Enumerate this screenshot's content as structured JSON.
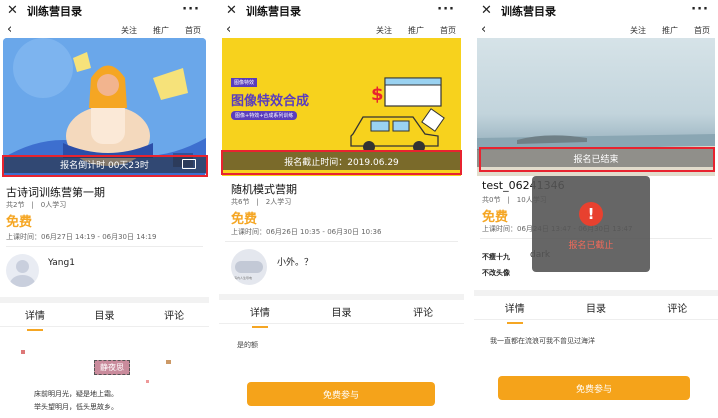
{
  "common": {
    "app_title": "训练营目录",
    "nav_follow": "关注",
    "nav_promote": "推广",
    "nav_home": "首页",
    "tabs": [
      "详情",
      "目录",
      "评论"
    ],
    "join_label": "免费参与",
    "accent_color": "#f5a623",
    "highlight_color": "#e8232f",
    "icons": [
      "close-icon",
      "more-icon",
      "back-icon",
      "image-icon",
      "alert-icon"
    ]
  },
  "panel1": {
    "banner_status": "报名倒计时 00天23时",
    "course_title": "古诗词训练营第一期",
    "meta": "共2节　|　0人学习",
    "price": "免费",
    "class_time": "上课时间：06月27日 14:19 - 06月30日 14:19",
    "teacher_name": "Yang1",
    "stamp_text": "静夜思",
    "poem_line1": "床前明月光，疑是地上霜。",
    "poem_line2": "举头望明月，低头思故乡。"
  },
  "panel2": {
    "banner_badge": "图像特效",
    "banner_title": "图像特效合成",
    "banner_sub": "图像+特效+合成系列训练",
    "banner_status": "报名截止时间：2019.06.29",
    "course_title": "随机模式营期",
    "meta": "共6节　|　2人学习",
    "price": "免费",
    "class_time": "上课时间：06月26日 10:35 - 06月30日 10:36",
    "teacher_name": "小外。？",
    "teacher_caption": "海内人生导电",
    "detail_text": "是的额"
  },
  "panel3": {
    "banner_status": "报名已结束",
    "course_title": "test_06241346",
    "meta": "共0节　|　10人学习",
    "price": "免费",
    "class_time": "上课时间：06月24日 13:47 - 06月30日 13:47",
    "teacher_name1": "不瘦十九",
    "teacher_name2": "dark",
    "teacher_name3": "不改头像",
    "toast_text": "报名已截止",
    "detail_text": "我一直都在流浪可我不曾见过海洋"
  }
}
